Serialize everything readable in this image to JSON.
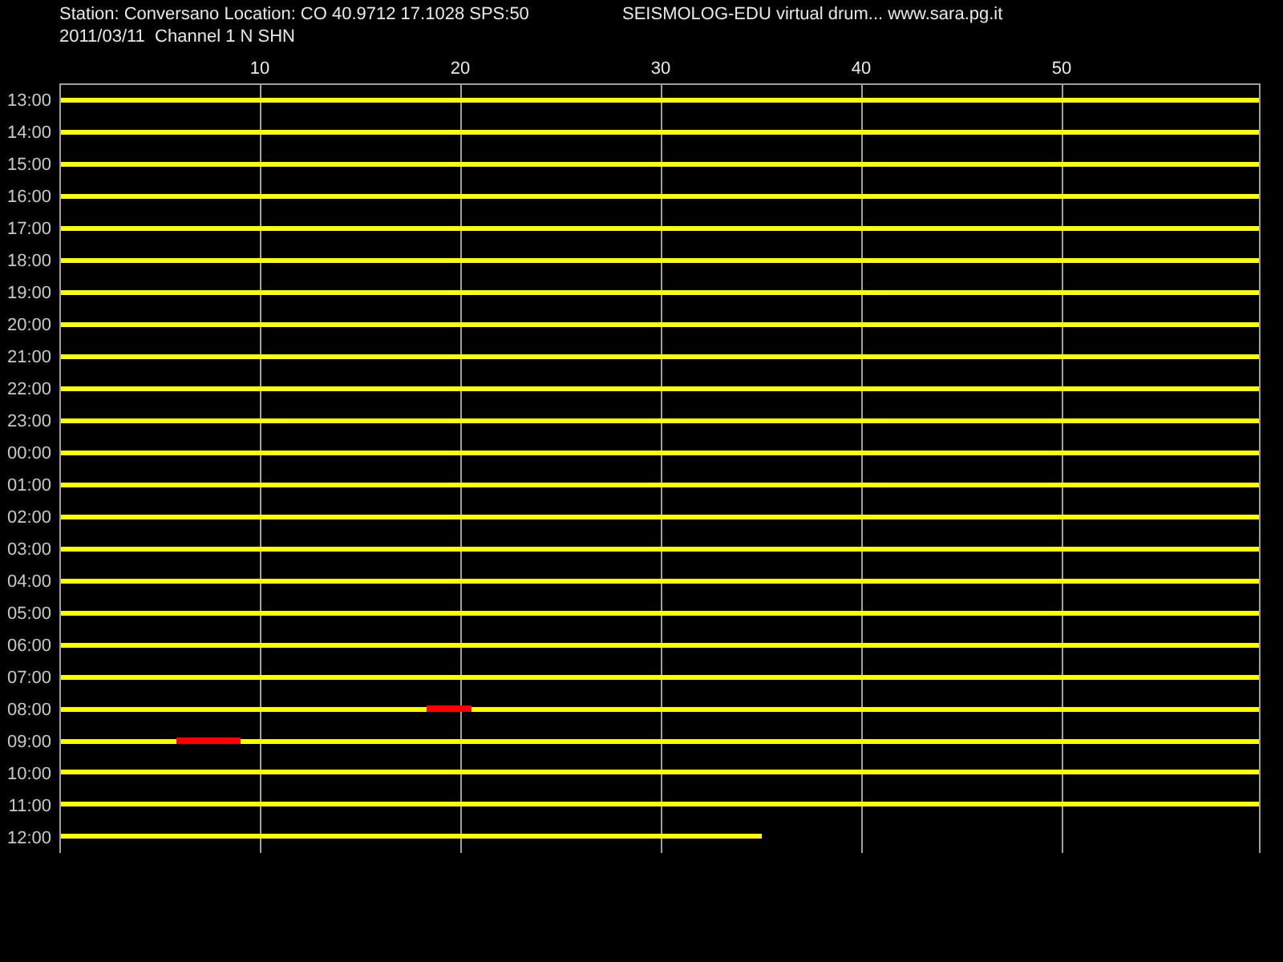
{
  "header": {
    "station_line": "Station: Conversano Location: CO 40.9712 17.1028 SPS:50",
    "title": "SEISMOLOG-EDU virtual drum... www.sara.pg.it",
    "channel_line": "2011/03/11  Channel 1 N SHN"
  },
  "minute_labels": [
    "10",
    "20",
    "30",
    "40",
    "50"
  ],
  "rows": [
    {
      "hour": "13:00",
      "level": 1,
      "triggered": false
    },
    {
      "hour": "14:00",
      "level": 1,
      "triggered": false
    },
    {
      "hour": "15:00",
      "level": 1,
      "triggered": false
    },
    {
      "hour": "16:00",
      "level": 1,
      "triggered": false
    },
    {
      "hour": "17:00",
      "level": 1,
      "triggered": false
    },
    {
      "hour": "18:00",
      "level": 1,
      "triggered": false
    },
    {
      "hour": "19:00",
      "level": 1,
      "triggered": false
    },
    {
      "hour": "20:00",
      "level": 1,
      "triggered": false
    },
    {
      "hour": "21:00",
      "level": 1,
      "triggered": false
    },
    {
      "hour": "22:00",
      "level": 1,
      "triggered": false
    },
    {
      "hour": "23:00",
      "level": 1,
      "triggered": false
    },
    {
      "hour": "00:00",
      "level": 1,
      "triggered": false
    },
    {
      "hour": "01:00",
      "level": 1,
      "triggered": false
    },
    {
      "hour": "02:00",
      "level": 1,
      "triggered": false
    },
    {
      "hour": "03:00",
      "level": 1,
      "triggered": false
    },
    {
      "hour": "04:00",
      "level": 1,
      "triggered": false
    },
    {
      "hour": "05:00",
      "level": 1,
      "triggered": false
    },
    {
      "hour": "06:00",
      "level": 1,
      "triggered": false
    },
    {
      "hour": "07:00",
      "level": 1,
      "triggered": false
    },
    {
      "hour": "08:00",
      "level": 1,
      "triggered": true
    },
    {
      "hour": "09:00",
      "level": 1,
      "triggered": true
    },
    {
      "hour": "10:00",
      "level": 1,
      "triggered": false
    },
    {
      "hour": "11:00",
      "level": 1,
      "triggered": false
    },
    {
      "hour": "12:00",
      "level": 0.585,
      "triggered": false
    }
  ]
}
